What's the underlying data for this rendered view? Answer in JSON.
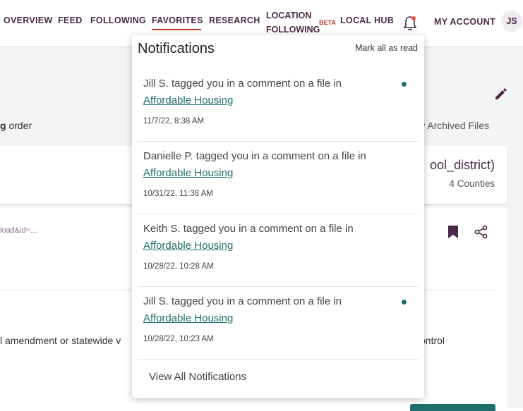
{
  "nav": {
    "items": [
      "OVERVIEW",
      "FEED",
      "FOLLOWING",
      "FAVORITES",
      "RESEARCH"
    ],
    "location_line1": "LOCATION",
    "location_line2": "FOLLOWING",
    "beta": "BETA",
    "local_hub": "LOCAL HUB",
    "my_account": "MY ACCOUNT",
    "avatar_initials": "JS",
    "bell_icon": "bell-icon",
    "active_color": "#c0392b"
  },
  "page": {
    "sort_bold": "g",
    "sort_rest": " order",
    "archived_link": "w Archived Files",
    "card1_title": "ool_district)",
    "card1_subtitle": "4 Counties",
    "card2_url": "load&id=...",
    "card2_text_left": "l amendment or statewide v",
    "card2_text_right": "ontrol"
  },
  "notifications": {
    "title": "Notifications",
    "mark_all": "Mark all as read",
    "items": [
      {
        "message": "Jill S. tagged you in a comment on a file in",
        "link": "Affordable Housing",
        "time": "11/7/22, 8:38 AM",
        "unread": true
      },
      {
        "message": "Danielle P. tagged you in a comment on a file in",
        "link": "Affordable Housing",
        "time": "10/31/22, 11:38 AM",
        "unread": false
      },
      {
        "message": "Keith S. tagged you in a comment on a file in",
        "link": "Affordable Housing",
        "time": "10/28/22, 10:28 AM",
        "unread": false
      },
      {
        "message": "Jill S. tagged you in a comment on a file in",
        "link": "Affordable Housing",
        "time": "10/28/22, 10:23 AM",
        "unread": true
      }
    ],
    "view_all": "View All Notifications",
    "accent_color": "#1f6f6d"
  }
}
